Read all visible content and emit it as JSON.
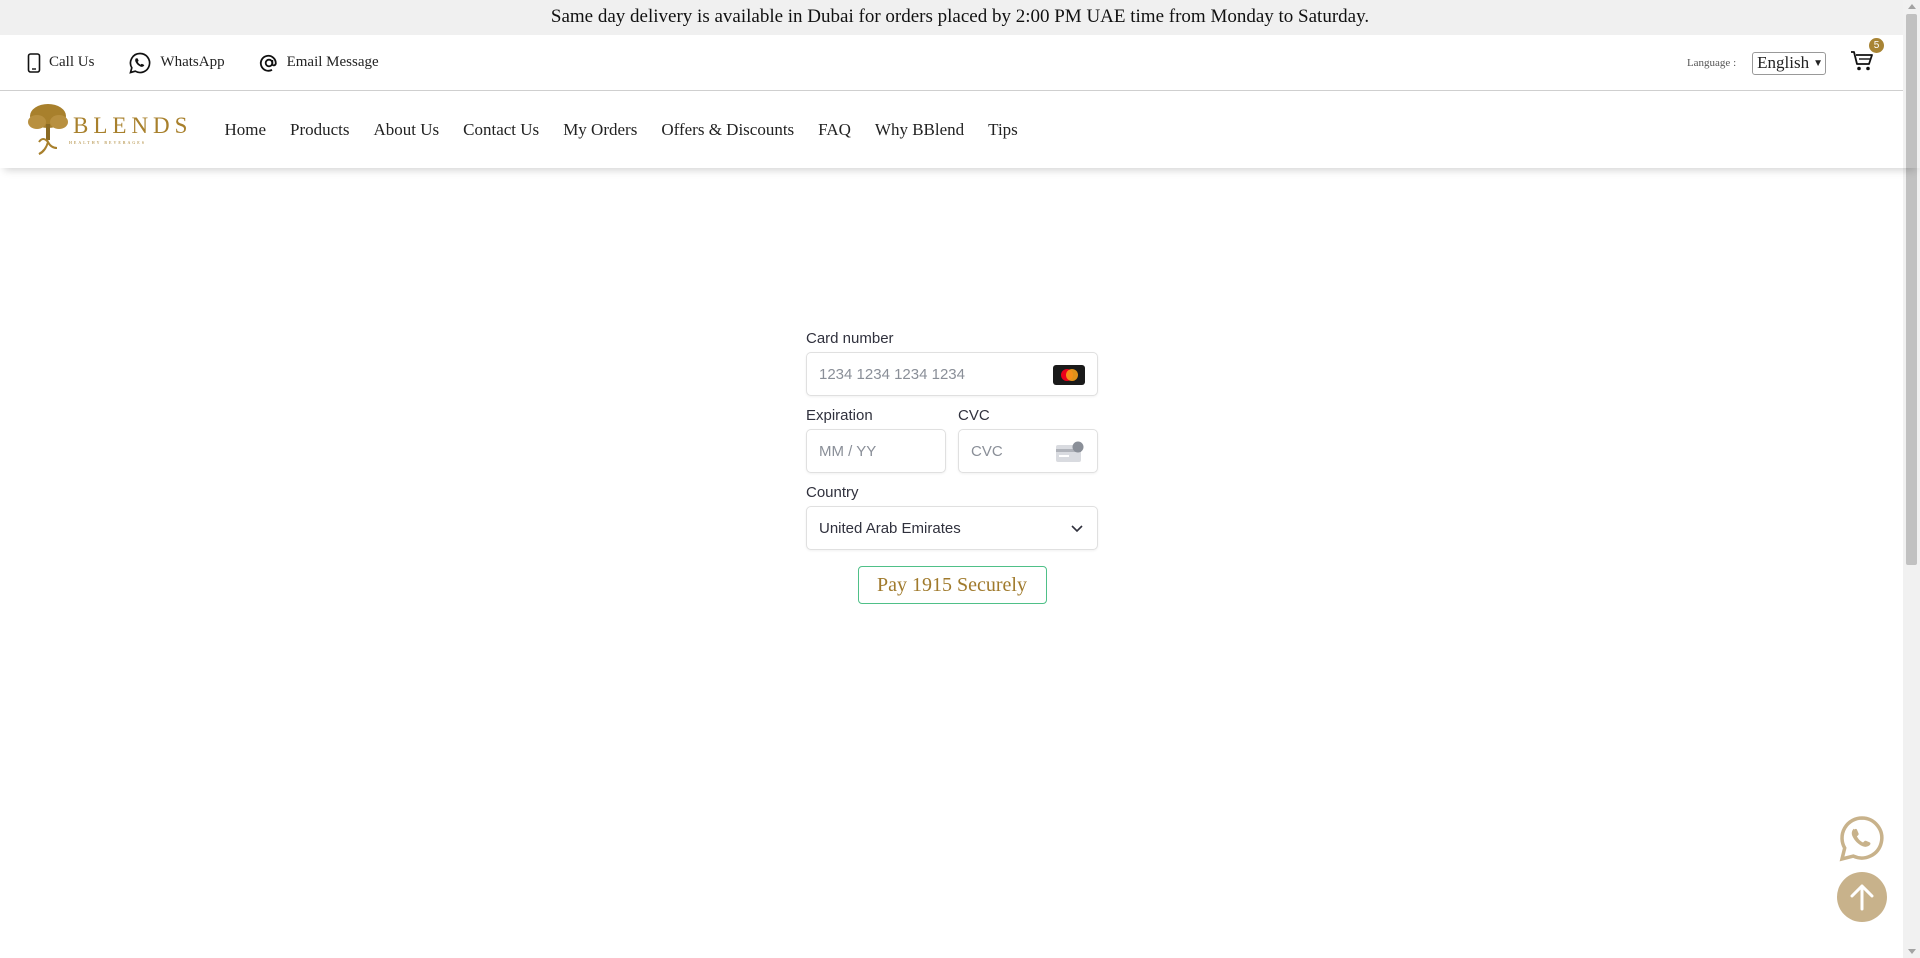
{
  "announcement": "Same day delivery is available in Dubai for orders placed by 2:00 PM UAE time from Monday to Saturday.",
  "topbar": {
    "contacts": [
      {
        "label": "Call Us",
        "icon": "phone-icon"
      },
      {
        "label": "WhatsApp",
        "icon": "whatsapp-icon"
      },
      {
        "label": "Email Message",
        "icon": "at-sign-icon"
      }
    ],
    "language_label": "Language :",
    "language_value": "English",
    "cart_count": "5"
  },
  "navbar": {
    "logo_text": "BLENDS",
    "logo_sub": "HEALTHY BEVERAGES",
    "items": [
      "Home",
      "Products",
      "About Us",
      "Contact Us",
      "My Orders",
      "Offers & Discounts",
      "FAQ",
      "Why BBlend",
      "Tips"
    ]
  },
  "payment": {
    "card_number_label": "Card number",
    "card_number_placeholder": "1234 1234 1234 1234",
    "expiration_label": "Expiration",
    "expiration_placeholder": "MM / YY",
    "cvc_label": "CVC",
    "cvc_placeholder": "CVC",
    "country_label": "Country",
    "country_value": "United Arab Emirates",
    "pay_button": "Pay 1915 Securely"
  },
  "colors": {
    "brand_gold": "#a8802c",
    "pay_border": "#4fc088",
    "floating_button": "#c8b28b"
  }
}
